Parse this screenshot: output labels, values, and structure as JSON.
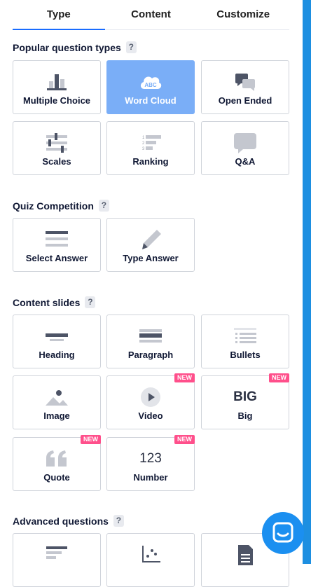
{
  "tabs": [
    {
      "label": "Type"
    },
    {
      "label": "Content"
    },
    {
      "label": "Customize"
    }
  ],
  "help_mark": "?",
  "new_badge": "NEW",
  "sections": {
    "popular": {
      "title": "Popular question types",
      "items": [
        {
          "label": "Multiple Choice",
          "icon": "bar-chart-icon"
        },
        {
          "label": "Word Cloud",
          "icon": "word-cloud-icon",
          "selected": true
        },
        {
          "label": "Open Ended",
          "icon": "speech-bubbles-icon"
        },
        {
          "label": "Scales",
          "icon": "sliders-icon"
        },
        {
          "label": "Ranking",
          "icon": "ranking-icon"
        },
        {
          "label": "Q&A",
          "icon": "qa-bubble-icon"
        }
      ]
    },
    "quiz": {
      "title": "Quiz Competition",
      "items": [
        {
          "label": "Select Answer",
          "icon": "list-lines-icon"
        },
        {
          "label": "Type Answer",
          "icon": "pencil-icon"
        }
      ]
    },
    "content": {
      "title": "Content slides",
      "items": [
        {
          "label": "Heading",
          "icon": "heading-icon"
        },
        {
          "label": "Paragraph",
          "icon": "paragraph-icon"
        },
        {
          "label": "Bullets",
          "icon": "bullets-icon"
        },
        {
          "label": "Image",
          "icon": "image-icon"
        },
        {
          "label": "Video",
          "icon": "play-icon",
          "new": true
        },
        {
          "label": "Big",
          "icon": "big-text-icon",
          "icon_text": "BIG",
          "new": true
        },
        {
          "label": "Quote",
          "icon": "quote-icon",
          "new": true
        },
        {
          "label": "Number",
          "icon": "number-icon",
          "icon_text": "123",
          "new": true
        }
      ]
    },
    "advanced": {
      "title": "Advanced questions",
      "items": [
        {
          "icon": "text-lines-icon"
        },
        {
          "icon": "scatter-plot-icon"
        },
        {
          "icon": "document-icon"
        }
      ]
    }
  },
  "chat": {
    "icon": "chat-icon"
  },
  "colors": {
    "accent": "#196cff",
    "selected_card": "#7aaef7",
    "new_badge": "#ff4f8b",
    "chat_button": "#1b8ff0"
  }
}
